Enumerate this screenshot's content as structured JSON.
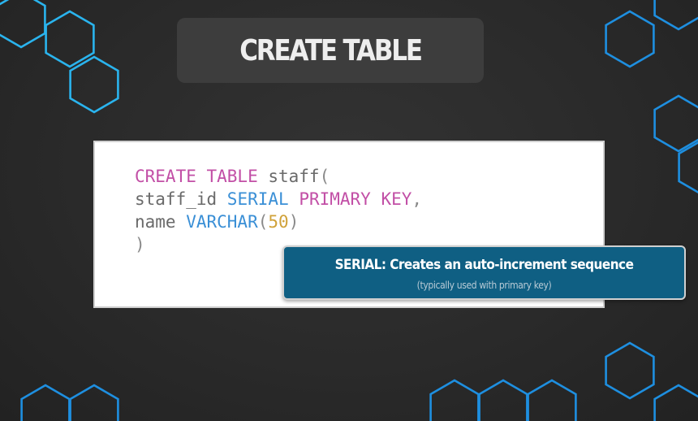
{
  "slide": {
    "title": "CREATE TABLE",
    "accent_color": "#2196e8",
    "hex_color": "#1e8fe0",
    "hex_color_light": "#2ab4ee"
  },
  "code": {
    "lines": [
      [
        {
          "t": "CREATE TABLE",
          "k": "kw"
        },
        {
          "t": " staff",
          "k": "plain"
        },
        {
          "t": "(",
          "k": "punc"
        }
      ],
      [
        {
          "t": "staff_id ",
          "k": "plain"
        },
        {
          "t": "SERIAL ",
          "k": "type"
        },
        {
          "t": "PRIMARY KEY",
          "k": "kw"
        },
        {
          "t": ",",
          "k": "punc"
        }
      ],
      [
        {
          "t": "name ",
          "k": "plain"
        },
        {
          "t": "VARCHAR",
          "k": "type"
        },
        {
          "t": "(",
          "k": "punc"
        },
        {
          "t": "50",
          "k": "num"
        },
        {
          "t": ")",
          "k": "punc"
        }
      ],
      [
        {
          "t": ")",
          "k": "punc"
        }
      ]
    ]
  },
  "tooltip": {
    "title": "SERIAL: Creates an auto-increment sequence",
    "subtitle": "(typically used with primary key)"
  }
}
